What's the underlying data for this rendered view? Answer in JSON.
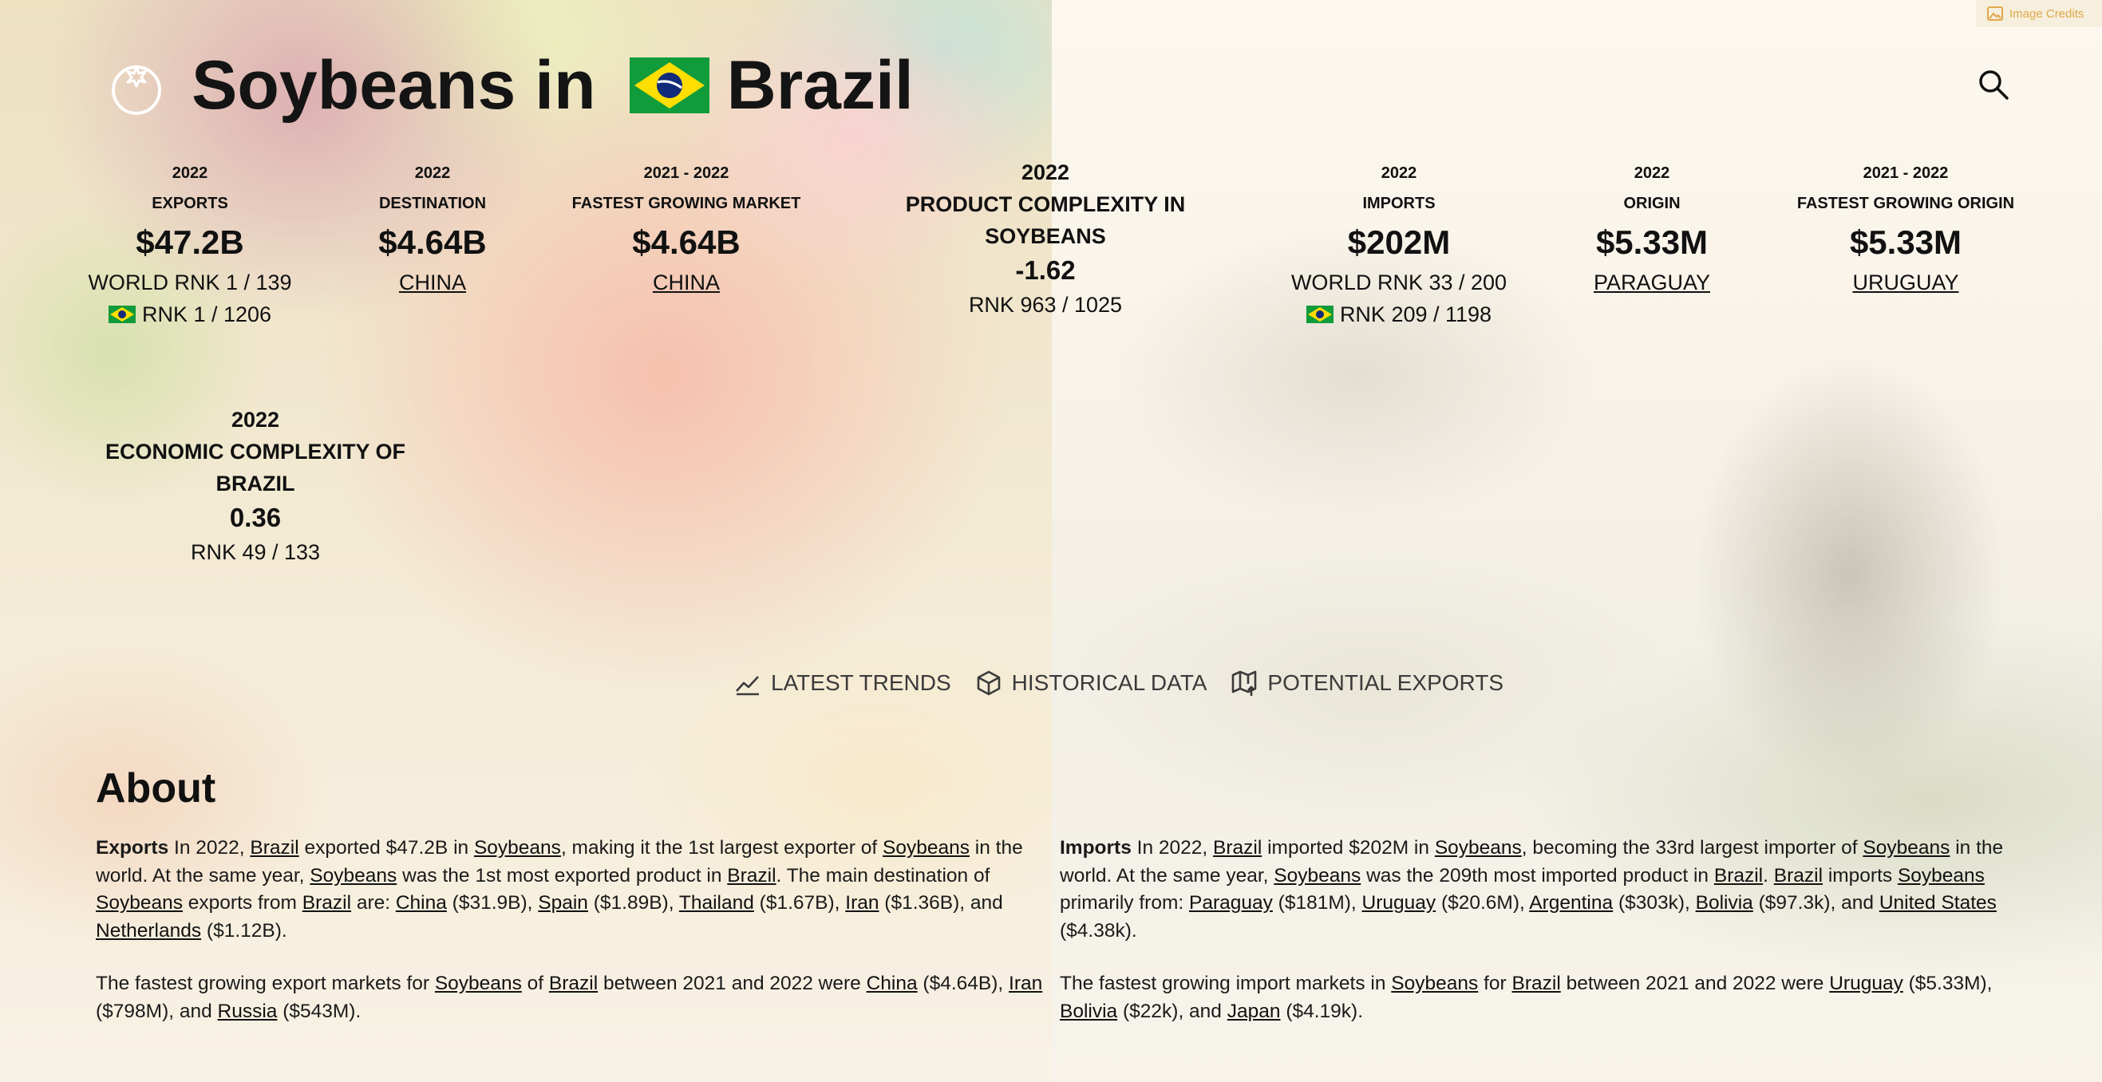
{
  "header": {
    "title_prefix": "Soybeans in",
    "title_country": "Brazil",
    "image_credits": "Image Credits"
  },
  "stats": [
    {
      "id": "exports",
      "year": "2022",
      "label": "EXPORTS",
      "value": "$47.2B",
      "world_rank": "WORLD RNK 1 / 139",
      "country_rank": "RNK 1 / 1206"
    },
    {
      "id": "destination",
      "year": "2022",
      "label": "DESTINATION",
      "value": "$4.64B",
      "link": "CHINA"
    },
    {
      "id": "fastest_market",
      "year": "2021 - 2022",
      "label": "FASTEST GROWING MARKET",
      "value": "$4.64B",
      "link": "CHINA"
    },
    {
      "id": "pci",
      "year": "2022",
      "label": "PRODUCT COMPLEXITY IN SOYBEANS",
      "value": "-1.62",
      "rank": "RNK 963 / 1025"
    },
    {
      "id": "imports",
      "year": "2022",
      "label": "IMPORTS",
      "value": "$202M",
      "world_rank": "WORLD RNK 33 / 200",
      "country_rank": "RNK 209 / 1198"
    },
    {
      "id": "origin",
      "year": "2022",
      "label": "ORIGIN",
      "value": "$5.33M",
      "link": "PARAGUAY"
    },
    {
      "id": "fastest_origin",
      "year": "2021 - 2022",
      "label": "FASTEST GROWING ORIGIN",
      "value": "$5.33M",
      "link": "URUGUAY"
    },
    {
      "id": "eci",
      "year": "2022",
      "label": "ECONOMIC COMPLEXITY OF BRAZIL",
      "value": "0.36",
      "rank": "RNK 49 / 133"
    }
  ],
  "tabs": [
    {
      "label": "LATEST TRENDS",
      "icon": "trend-line-icon"
    },
    {
      "label": "HISTORICAL DATA",
      "icon": "cube-icon"
    },
    {
      "label": "POTENTIAL EXPORTS",
      "icon": "map-arrow-icon"
    }
  ],
  "about": {
    "title": "About",
    "exports_heading": "Exports",
    "imports_heading": "Imports",
    "links": {
      "brazil": "Brazil",
      "soybeans": "Soybeans",
      "china": "China",
      "spain": "Spain",
      "thailand": "Thailand",
      "iran": "Iran",
      "netherlands": "Netherlands",
      "russia": "Russia",
      "paraguay": "Paraguay",
      "uruguay": "Uruguay",
      "argentina": "Argentina",
      "bolivia": "Bolivia",
      "united_states": "United States",
      "japan": "Japan"
    },
    "text": {
      "e1": " In 2022, ",
      "e2": " exported $47.2B in ",
      "e3": ", making it the 1st largest exporter of ",
      "e4": " in the world. At the same year, ",
      "e5": " was the 1st most exported product in ",
      "e6": ". The main destination of ",
      "e7": " exports from ",
      "e8": " are: ",
      "e9": " ($31.9B), ",
      "e10": " ($1.89B), ",
      "e11": " ($1.67B), ",
      "e12": " ($1.36B), and ",
      "e13": " ($1.12B).",
      "f1": "The fastest growing export markets for ",
      "f2": " of ",
      "f3": " between 2021 and 2022 were ",
      "f4": " ($4.64B), ",
      "f5": " ($798M), and ",
      "f6": " ($543M).",
      "i1": " In 2022, ",
      "i2": " imported $202M in ",
      "i3": ", becoming the 33rd largest importer of ",
      "i4": " in the world. At the same year, ",
      "i5": " was the 209th most imported product in ",
      "i6": ". ",
      "i7": " imports ",
      "i8": " primarily from: ",
      "i9": " ($181M), ",
      "i10": " ($20.6M), ",
      "i11": " ($303k), ",
      "i12": " ($97.3k), and ",
      "i13": " ($4.38k).",
      "g1": "The fastest growing import markets in ",
      "g2": " for ",
      "g3": " between 2021 and 2022 were ",
      "g4": " ($5.33M), ",
      "g5": " ($22k), and ",
      "g6": " ($4.19k)."
    }
  },
  "colors": {
    "flag_green": "#109c3a",
    "flag_yellow": "#fedd00",
    "flag_blue": "#122a7a",
    "credits": "#e0a84a"
  }
}
